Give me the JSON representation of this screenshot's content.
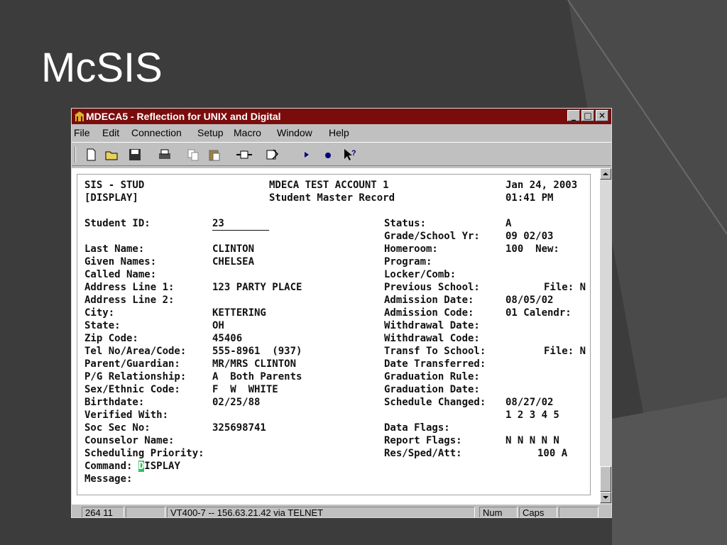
{
  "slide": {
    "title": "McSIS"
  },
  "window": {
    "title": "MDECA5 - Reflection for UNIX and Digital",
    "controls": [
      "minimize",
      "maximize",
      "close"
    ]
  },
  "menu": [
    "File",
    "Edit",
    "Connection",
    "Setup",
    "Macro",
    "Window",
    "Help"
  ],
  "toolbar": [
    "new-icon",
    "open-icon",
    "save-icon",
    "print-icon",
    "copy-icon",
    "paste-icon",
    "connect-icon",
    "macro-icon",
    "play-icon",
    "record-icon",
    "help-pointer-icon"
  ],
  "screen": {
    "header": {
      "system": "SIS - STUD",
      "mode": "[DISPLAY]",
      "account": "MDECA TEST ACCOUNT 1",
      "record_title": "Student Master Record",
      "date": "Jan 24, 2003",
      "time": "01:41 PM"
    },
    "left": {
      "student_id_label": "Student ID:",
      "student_id": "23",
      "last_name_label": "Last Name:",
      "last_name": "CLINTON",
      "given_names_label": "Given Names:",
      "given_names": "CHELSEA",
      "called_name_label": "Called Name:",
      "address1_label": "Address Line 1:",
      "address1": "123 PARTY PLACE",
      "address2_label": "Address Line 2:",
      "city_label": "City:",
      "city": "KETTERING",
      "state_label": "State:",
      "state": "OH",
      "zip_label": "Zip Code:",
      "zip": "45406",
      "tel_label": "Tel No/Area/Code:",
      "tel": "555-8961  (937)",
      "parent_label": "Parent/Guardian:",
      "parent": "MR/MRS CLINTON",
      "pg_rel_label": "P/G Relationship:",
      "pg_rel": "A  Both Parents",
      "sex_label": "Sex/Ethnic Code:",
      "sex": "F  W  WHITE",
      "birthdate_label": "Birthdate:",
      "birthdate": "02/25/88",
      "verified_label": "Verified With:",
      "ssn_label": "Soc Sec No:",
      "ssn": "325698741",
      "counselor_label": "Counselor Name:",
      "sched_priority_label": "Scheduling Priority:",
      "command_label": "Command: ",
      "command_cursor": "D",
      "command_rest": "ISPLAY",
      "message_label": "Message:"
    },
    "right": {
      "status_label": "Status:",
      "status": "A",
      "grade_label": "Grade/School Yr:",
      "grade": "09 02/03",
      "homeroom_label": "Homeroom:",
      "homeroom": "100  New:",
      "program_label": "Program:",
      "locker_label": "Locker/Comb:",
      "prev_school_label": "Previous School:",
      "prev_school_file": "File: N",
      "adm_date_label": "Admission Date:",
      "adm_date": "08/05/02",
      "adm_code_label": "Admission Code:",
      "adm_code": "01 Calendr:",
      "wd_date_label": "Withdrawal Date:",
      "wd_code_label": "Withdrawal Code:",
      "transf_label": "Transf To School:",
      "transf_file": "File: N",
      "date_transf_label": "Date Transferred:",
      "grad_rule_label": "Graduation Rule:",
      "grad_date_label": "Graduation Date:",
      "sched_changed_label": "Schedule Changed:",
      "sched_changed": "08/27/02",
      "sched_numbers": "1 2 3 4 5",
      "data_flags_label": "Data Flags:",
      "report_flags_label": "Report Flags:",
      "report_flags": "N N N N N",
      "res_label": "Res/Sped/Att:",
      "res": "100 A"
    }
  },
  "status": {
    "position": "264  11",
    "connection": "VT400-7 -- 156.63.21.42 via TELNET",
    "num": "Num",
    "caps": "Caps"
  },
  "colors": {
    "titlebar": "#7a0c0c",
    "cursor": "#30c060",
    "slide_bg": "#3c3c3c"
  }
}
